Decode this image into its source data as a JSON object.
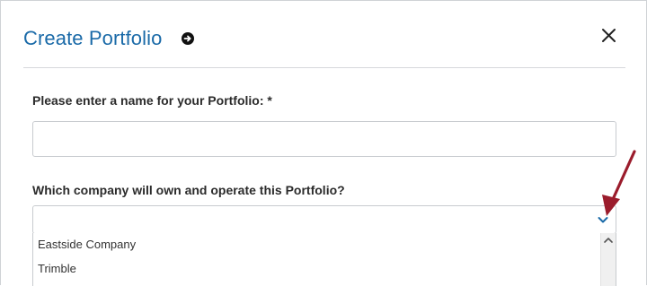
{
  "dialog": {
    "title": "Create Portfolio",
    "info_icon": "arrow-right-circle-icon",
    "close_icon": "close-icon"
  },
  "form": {
    "name_label": "Please enter a name for your Portfolio: *",
    "name_value": "",
    "company_label": "Which company will own and operate this Portfolio?",
    "company_selected": ""
  },
  "dropdown": {
    "options": [
      {
        "label": "Eastside Company"
      },
      {
        "label": "Trimble"
      }
    ]
  },
  "colors": {
    "title": "#1a6aa8",
    "annotation_arrow": "#9b1c2c",
    "chevron": "#1a6aa8"
  }
}
